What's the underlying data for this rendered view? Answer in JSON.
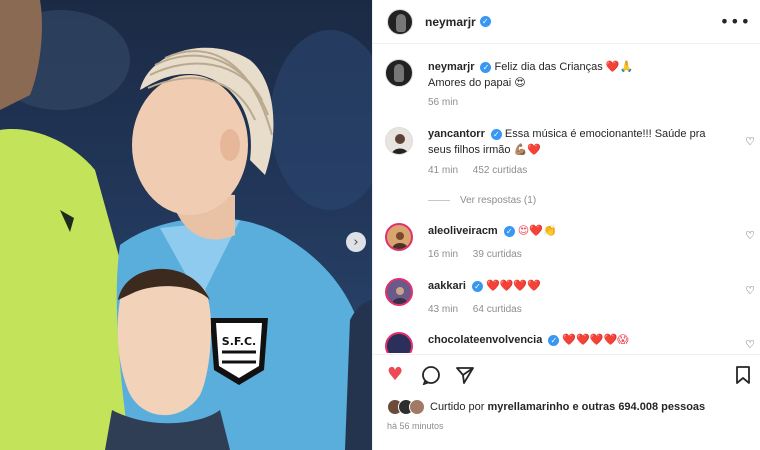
{
  "post": {
    "header_username": "neymarjr",
    "caption": {
      "username": "neymarjr",
      "line1": "Feliz dia das Crianças",
      "line1_emoji": "❤️🙏",
      "line2": "Amores do papai",
      "line2_emoji": "😍",
      "time": "56 min"
    },
    "comments": [
      {
        "username": "yancantorr",
        "text": "Essa música é emocionante!!! Saúde pra seus filhos irmão",
        "emoji": "💪🏽❤️",
        "time": "41 min",
        "likes": "452 curtidas",
        "replies": "Ver respostas (1)"
      },
      {
        "username": "aleoliveiracm",
        "text": "",
        "emoji": "😍❤️👏",
        "time": "16 min",
        "likes": "39 curtidas"
      },
      {
        "username": "aakkari",
        "text": "",
        "emoji": "❤️❤️❤️❤️",
        "time": "43 min",
        "likes": "64 curtidas"
      },
      {
        "username": "chocolateenvolvencia",
        "text": "",
        "emoji": "❤️❤️❤️❤️😱"
      }
    ],
    "liked_by": {
      "prefix": "Curtido por",
      "user": "myrellamarinho",
      "suffix": "e outras 694.008 pessoas"
    },
    "time_ago": "há 56 minutos",
    "icons": {
      "verified": "verified-badge-icon",
      "more": "more-options-icon",
      "like": "heart-icon",
      "comment": "comment-icon",
      "share": "share-icon",
      "save": "bookmark-icon",
      "next": "chevron-right-icon"
    },
    "colors": {
      "verified": "#3897f0",
      "like": "#ed4956",
      "jersey": "#5aaedc"
    }
  }
}
